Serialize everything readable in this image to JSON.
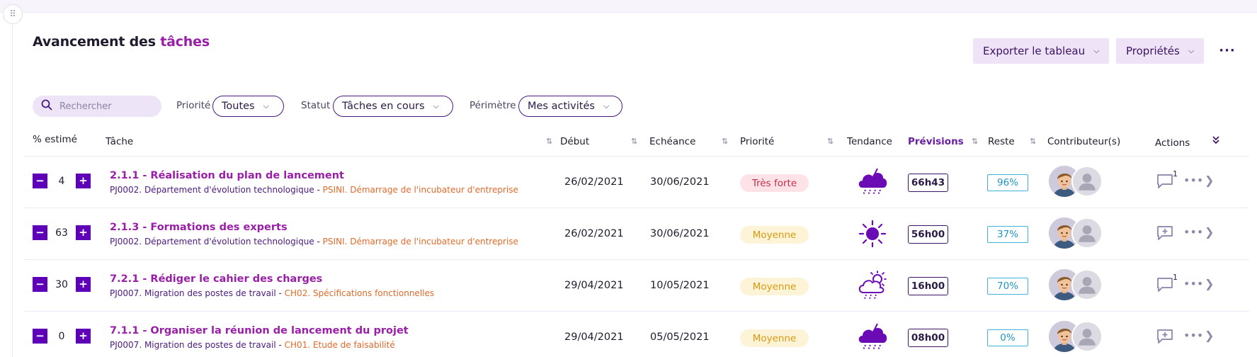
{
  "header": {
    "title_part1": "Avancement des ",
    "title_part2": "tâches",
    "export_label": "Exporter le tableau",
    "props_label": "Propriétés",
    "more_label": "···"
  },
  "filters": {
    "search_placeholder": "Rechercher",
    "priority_label": "Priorité",
    "priority_value": "Toutes",
    "status_label": "Statut",
    "status_value": "Tâches en cours",
    "scope_label": "Périmètre",
    "scope_value": "Mes activités"
  },
  "columns": {
    "estimated": "% estimé",
    "task": "Tâche",
    "start": "Début",
    "due": "Echéance",
    "priority": "Priorité",
    "trend": "Tendance",
    "forecast": "Prévisions",
    "remaining": "Reste",
    "contributors": "Contributeur(s)",
    "actions": "Actions"
  },
  "rows": [
    {
      "estimate": "4",
      "title": "2.1.1 - Réalisation du plan de lancement",
      "project": "PJ0002. Département d'évolution technologique - ",
      "phase": "PSINI. Démarrage de l'incubateur d'entreprise",
      "start": "26/02/2021",
      "due": "30/06/2021",
      "priority": "Très forte",
      "trend_icon": "storm-cloud-icon",
      "forecast": "66h43",
      "remaining": "96%",
      "comments": "1"
    },
    {
      "estimate": "63",
      "title": "2.1.3 - Formations des experts",
      "project": "PJ0002. Département d'évolution technologique - ",
      "phase": "PSINI. Démarrage de l'incubateur d'entreprise",
      "start": "26/02/2021",
      "due": "30/06/2021",
      "priority": "Moyenne",
      "trend_icon": "sun-icon",
      "forecast": "56h00",
      "remaining": "37%",
      "comments": ""
    },
    {
      "estimate": "30",
      "title": "7.2.1 - Rédiger le cahier des charges",
      "project": "PJ0007. Migration des postes de travail - ",
      "phase": "CH02. Spécifications fonctionnelles",
      "start": "29/04/2021",
      "due": "10/05/2021",
      "priority": "Moyenne",
      "trend_icon": "partly-cloudy-rain-icon",
      "forecast": "16h00",
      "remaining": "70%",
      "comments": "1"
    },
    {
      "estimate": "0",
      "title": "7.1.1 - Organiser la réunion de lancement du projet",
      "project": "PJ0007. Migration des postes de travail - ",
      "phase": "CH01. Etude de faisabilité",
      "start": "29/04/2021",
      "due": "05/05/2021",
      "priority": "Moyenne",
      "trend_icon": "storm-cloud-icon",
      "forecast": "08h00",
      "remaining": "0%",
      "comments": ""
    }
  ],
  "colors": {
    "accent": "#9a1fa8",
    "stepper": "#5d00b7",
    "orange": "#e16a2a",
    "prio_high_bg": "#fde2e7",
    "prio_high_text": "#c0304b",
    "prio_mid_bg": "#fdf3d6",
    "prio_mid_text": "#d89a12",
    "remaining": "#1f95c0"
  }
}
